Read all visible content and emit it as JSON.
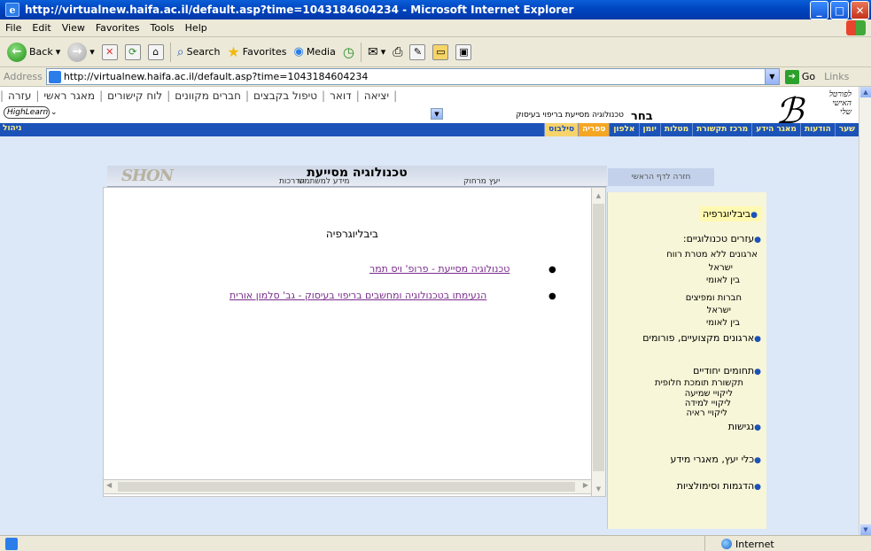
{
  "window": {
    "title": "http://virtualnew.haifa.ac.il/default.asp?time=1043184604234 - Microsoft Internet Explorer"
  },
  "menu": [
    "File",
    "Edit",
    "View",
    "Favorites",
    "Tools",
    "Help"
  ],
  "toolbar": {
    "back": "Back",
    "search": "Search",
    "favorites": "Favorites",
    "media": "Media"
  },
  "address": {
    "label": "Address",
    "url": "http://virtualnew.haifa.ac.il/default.asp?time=1043184604234",
    "go": "Go",
    "links": "Links"
  },
  "topnav": {
    "items": [
      "יציאה",
      "דואר",
      "טיפול בקבצים",
      "חברים מקוונים",
      "לוח קישורים",
      "מאגר ראשי",
      "עזרה"
    ],
    "portal_lines": [
      "לפורטל",
      "האישי",
      "שלי"
    ]
  },
  "course_select": {
    "highlearn": "HighLearn",
    "selected": "טכנולוגיה מסייעת בריפוי בעיסוק",
    "choose_label": "בחר"
  },
  "bluenav": {
    "admin": "ניהול",
    "items": [
      "שער",
      "הודעות",
      "מאגר הידע",
      "מרכז תקשורת",
      "מטלות",
      "יומן",
      "אלפון",
      "ספריה",
      "סילבוס"
    ],
    "active_index": 7,
    "active2_index": 8
  },
  "course": {
    "title": "טכנולוגיה מסייעת",
    "logo": "SHON",
    "tabs": [
      "יעץ מרחוק",
      "מידע למשתמש",
      "הדרכות"
    ],
    "back_home": "חזרה לדף הראשי"
  },
  "content": {
    "heading": "ביבליוגרפיה",
    "links": [
      "טכנולוגיה מסייעת - פרופ' ויס תמר",
      "הנעימתו בטכנולוגיה ומחשבים בריפוי בעיסוק - גב' סלמון אורית"
    ]
  },
  "sidebar": {
    "bibliography": "ביבליוגרפיה",
    "tech_aids": "עזרים טכנולוגיים:",
    "nonprofit": "ארגונים ללא מטרת רווח",
    "israel1": "ישראל",
    "intl1": "בין לאומי",
    "companies": "חברות ומפיצים",
    "israel2": "ישראל",
    "intl2": "בין לאומי",
    "professional": "ארגונים מקצועיים, פורומים",
    "special": "תחומים יחודיים",
    "aac": "תקשורת תומכת חלופית",
    "hearing": "ליקויי שמיעה",
    "learning": "ליקויי למידה",
    "vision": "ליקויי ראיה",
    "accessibility": "נגישות",
    "consult": "כלי יעץ, מאגרי מידע",
    "demos": "הדגמות וסימולציות"
  },
  "status": {
    "zone": "Internet"
  }
}
